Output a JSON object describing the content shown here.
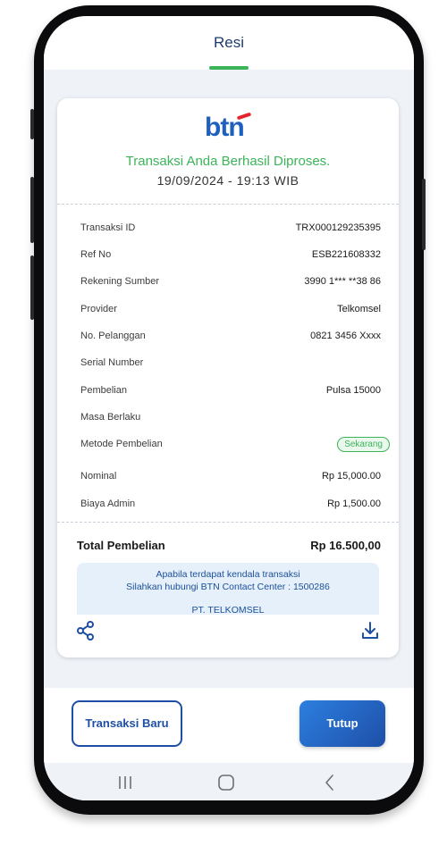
{
  "header": {
    "title": "Resi"
  },
  "receipt": {
    "logo_text": "btn",
    "success_message": "Transaksi Anda Berhasil Diproses.",
    "datetime": "19/09/2024 - 19:13 WIB",
    "rows": [
      {
        "label": "Transaksi ID",
        "value": "TRX000129235395"
      },
      {
        "label": "Ref No",
        "value": "ESB221608332"
      },
      {
        "label": "Rekening Sumber",
        "value": "3990 1*** **38 86"
      },
      {
        "label": "Provider",
        "value": "Telkomsel"
      },
      {
        "label": "No. Pelanggan",
        "value": "0821 3456 Xxxx"
      },
      {
        "label": "Serial Number",
        "value": ""
      },
      {
        "label": "Pembelian",
        "value": "Pulsa 15000"
      },
      {
        "label": "Masa Berlaku",
        "value": ""
      },
      {
        "label": "Metode Pembelian",
        "value": "Sekarang"
      },
      {
        "label": "Nominal",
        "value": "Rp 15,000.00"
      },
      {
        "label": "Biaya Admin",
        "value": "Rp 1,500.00"
      }
    ],
    "total": {
      "label": "Total Pembelian",
      "value": "Rp 16.500,00"
    },
    "info": {
      "line1": "Apabila terdapat kendala transaksi",
      "line2": "Silahkan hubungi BTN Contact Center : 1500286",
      "provider": "PT. TELKOMSEL"
    },
    "icons": {
      "share": "share-icon",
      "download": "download-icon"
    }
  },
  "actions": {
    "new_transaction": "Transaksi Baru",
    "close": "Tutup"
  },
  "navbar": {
    "recents": "recents-icon",
    "home": "home-icon",
    "back": "back-icon"
  },
  "colors": {
    "primary": "#1e4fa6",
    "success": "#3cb55a",
    "brand_red": "#e4242c",
    "background": "#eff3f8"
  }
}
